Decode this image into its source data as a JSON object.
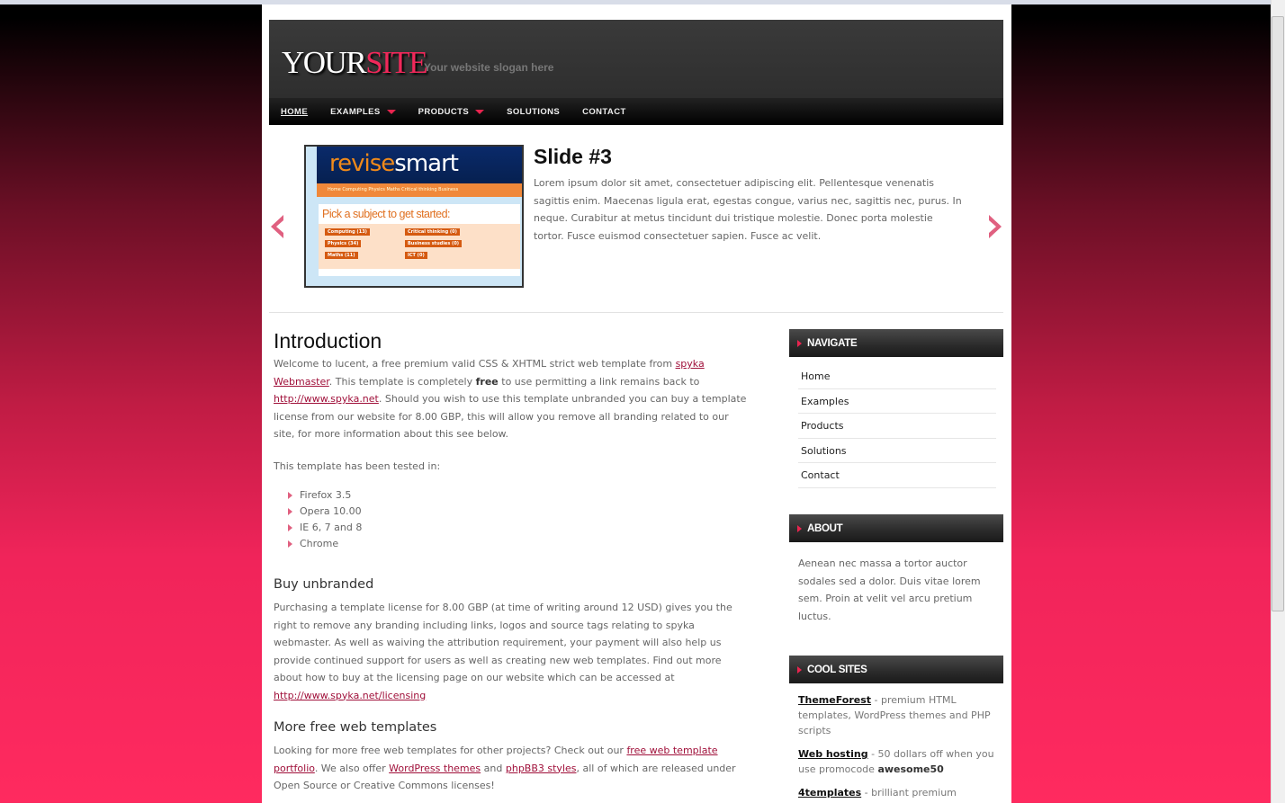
{
  "logo": {
    "your": "YOUR",
    "site": "SITE",
    "slogan": "Your website slogan here"
  },
  "nav": [
    {
      "label": "HOME",
      "dropdown": false
    },
    {
      "label": "EXAMPLES",
      "dropdown": true
    },
    {
      "label": "PRODUCTS",
      "dropdown": true
    },
    {
      "label": "SOLUTIONS",
      "dropdown": false
    },
    {
      "label": "CONTACT",
      "dropdown": false
    }
  ],
  "slider": {
    "title": "Slide #3",
    "text": "Lorem ipsum dolor sit amet, consectetuer adipiscing elit. Pellentesque venenatis sagittis enim. Maecenas ligula erat, egestas congue, varius nec, sagittis nec, purus. In neque. Curabitur at metus tincidunt dui tristique molestie. Donec porta molestie tortor. Fusce euismod consectetuer sapien. Fusce ac velit.",
    "image": {
      "brand_a": "revise",
      "brand_b": "smart",
      "menu": "Home   Computing   Physics   Maths   Critical thinking   Business",
      "heading": "Pick a subject to get started:",
      "tags": [
        "Computing (13)",
        "Physics (34)",
        "Maths (11)",
        "Critical thinking (0)",
        "Business studies (0)",
        "ICT (0)"
      ]
    }
  },
  "main": {
    "intro_title": "Introduction",
    "intro_1": "Welcome to lucent, a free premium valid CSS & XHTML strict web template from ",
    "intro_link1": "spyka Webmaster",
    "intro_2": ". This template is completely ",
    "intro_free": "free",
    "intro_3": " to use permitting a link remains back to ",
    "intro_link2": "http://www.spyka.net",
    "intro_4": ". Should you wish to use this template unbranded you can buy a template license from our website for 8.00 GBP, this will allow you remove all branding related to our site, for more information about this see below.",
    "tested_label": "This template has been tested in:",
    "browsers": [
      "Firefox 3.5",
      "Opera 10.00",
      "IE 6, 7 and 8",
      "Chrome"
    ],
    "buy_title": "Buy unbranded",
    "buy_text": "Purchasing a template license for 8.00 GBP (at time of writing around 12 USD) gives you the right to remove any branding including links, logos and source tags relating to spyka webmaster. As well as waiving the attribution requirement, your payment will also help us provide continued support for users as well as creating new web templates. Find out more about how to buy at the licensing page on our website which can be accessed at ",
    "buy_link": "http://www.spyka.net/licensing",
    "more_title": "More free web templates",
    "more_1": "Looking for more free web templates for other projects? Check out our ",
    "more_link1": "free web template portfolio",
    "more_2": ". We also offer ",
    "more_link2": "WordPress themes",
    "more_3": " and ",
    "more_link3": "phpBB3 styles",
    "more_4": ", all of which are released under Open Source or Creative Commons licenses!"
  },
  "sidebar": {
    "navigate_title": "NAVIGATE",
    "navigate": [
      "Home",
      "Examples",
      "Products",
      "Solutions",
      "Contact"
    ],
    "about_title": "ABOUT",
    "about_text": "Aenean nec massa a tortor auctor sodales sed a dolor. Duis vitae lorem sem. Proin at velit vel arcu pretium luctus.",
    "cool_title": "COOL SITES",
    "cool": [
      {
        "name": "ThemeForest",
        "desc": " - premium HTML templates, WordPress themes and PHP scripts"
      },
      {
        "name": "Web hosting",
        "desc": " - 50 dollars off when you use promocode ",
        "bold": "awesome50"
      },
      {
        "name": "4templates",
        "desc": " - brilliant premium"
      }
    ]
  },
  "colors": {
    "accent": "#e8244f",
    "link": "#a0103a",
    "header": "#333333"
  }
}
